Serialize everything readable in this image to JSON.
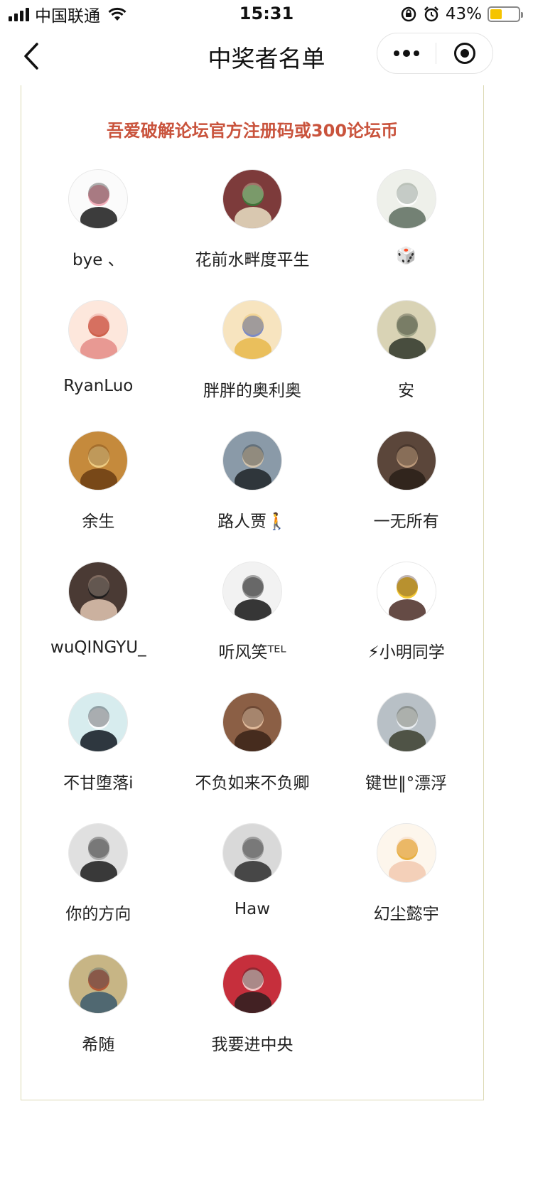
{
  "status_bar": {
    "carrier": "中国联通",
    "time": "15:31",
    "battery_percent": "43%",
    "battery_level": 0.43,
    "battery_color": "#f5c400"
  },
  "nav": {
    "title": "中奖者名单",
    "back_icon": "chevron-left-icon",
    "more_icon": "more-dots-icon",
    "close_icon": "target-circle-icon"
  },
  "prize": {
    "title": "吾爱破解论坛官方注册码或300论坛币",
    "title_color": "#c9533c"
  },
  "winners": [
    {
      "name": "bye 、",
      "avatar": {
        "bg": "#fbfbfb",
        "fg": "#1a1a1a",
        "accent": "#f3a5b3",
        "kind": "girl-sketch"
      }
    },
    {
      "name": "花前水畔度平生",
      "avatar": {
        "bg": "#7d3b3b",
        "fg": "#e9e2c6",
        "accent": "#3a7a3a",
        "kind": "toy"
      }
    },
    {
      "name": "🎲",
      "avatar": {
        "bg": "#eef0ea",
        "fg": "#5d6d5f",
        "accent": "#ffffff",
        "kind": "anime"
      }
    },
    {
      "name": "RyanLuo",
      "avatar": {
        "bg": "#fde7dc",
        "fg": "#e48b86",
        "accent": "#c9533c",
        "kind": "pig"
      }
    },
    {
      "name": "胖胖的奥利奥",
      "avatar": {
        "bg": "#f7e4bf",
        "fg": "#e8b94a",
        "accent": "#6c7fc7",
        "kind": "anime"
      }
    },
    {
      "name": "安",
      "avatar": {
        "bg": "#d9d3b5",
        "fg": "#2e3529",
        "accent": "#9aa083",
        "kind": "boy"
      }
    },
    {
      "name": "余生",
      "avatar": {
        "bg": "#c58a3c",
        "fg": "#6a3c12",
        "accent": "#f1d28a",
        "kind": "boxes"
      }
    },
    {
      "name": "路人贾🚶",
      "avatar": {
        "bg": "#8a9aa8",
        "fg": "#1e2428",
        "accent": "#d7c7ad",
        "kind": "silhouette"
      }
    },
    {
      "name": "一无所有",
      "avatar": {
        "bg": "#5b463a",
        "fg": "#2a2019",
        "accent": "#c5a282",
        "kind": "room"
      }
    },
    {
      "name": "wuQINGYU_",
      "avatar": {
        "bg": "#4a3a34",
        "fg": "#e2c7b3",
        "accent": "#1b1b1b",
        "kind": "portrait"
      }
    },
    {
      "name": "听风笑ᵀᴱᴸ",
      "avatar": {
        "bg": "#f2f2f2",
        "fg": "#151515",
        "accent": "#8c8c8c",
        "kind": "manga"
      }
    },
    {
      "name": "⚡小明同学",
      "avatar": {
        "bg": "#ffffff",
        "fg": "#4a2b24",
        "accent": "#f2c21f",
        "kind": "girl-crown"
      }
    },
    {
      "name": "不甘堕落i",
      "avatar": {
        "bg": "#d7ecee",
        "fg": "#101820",
        "accent": "#ffffff",
        "kind": "tunnel"
      }
    },
    {
      "name": "不负如来不负卿",
      "avatar": {
        "bg": "#8b5f45",
        "fg": "#3a2318",
        "accent": "#e9c4a4",
        "kind": "child"
      }
    },
    {
      "name": "键世‖°漂浮",
      "avatar": {
        "bg": "#b8c0c6",
        "fg": "#3c3f2f",
        "accent": "#eef2f4",
        "kind": "mountain"
      }
    },
    {
      "name": "你的方向",
      "avatar": {
        "bg": "#e0e0e0",
        "fg": "#1b1b1b",
        "accent": "#a5a5a5",
        "kind": "scream"
      }
    },
    {
      "name": "Haw",
      "avatar": {
        "bg": "#d9d9d9",
        "fg": "#2d2d2d",
        "accent": "#9a9a9a",
        "kind": "cloud"
      }
    },
    {
      "name": "幻尘懿宇",
      "avatar": {
        "bg": "#fdf6ec",
        "fg": "#f2c9b0",
        "accent": "#e6a82e",
        "kind": "pig"
      }
    },
    {
      "name": "希随",
      "avatar": {
        "bg": "#c7b585",
        "fg": "#3b5a6d",
        "accent": "#b0502f",
        "kind": "birds"
      }
    },
    {
      "name": "我要进中央",
      "avatar": {
        "bg": "#c62f3c",
        "fg": "#2a1e1e",
        "accent": "#f3d4d0",
        "kind": "girl-dark"
      }
    }
  ]
}
